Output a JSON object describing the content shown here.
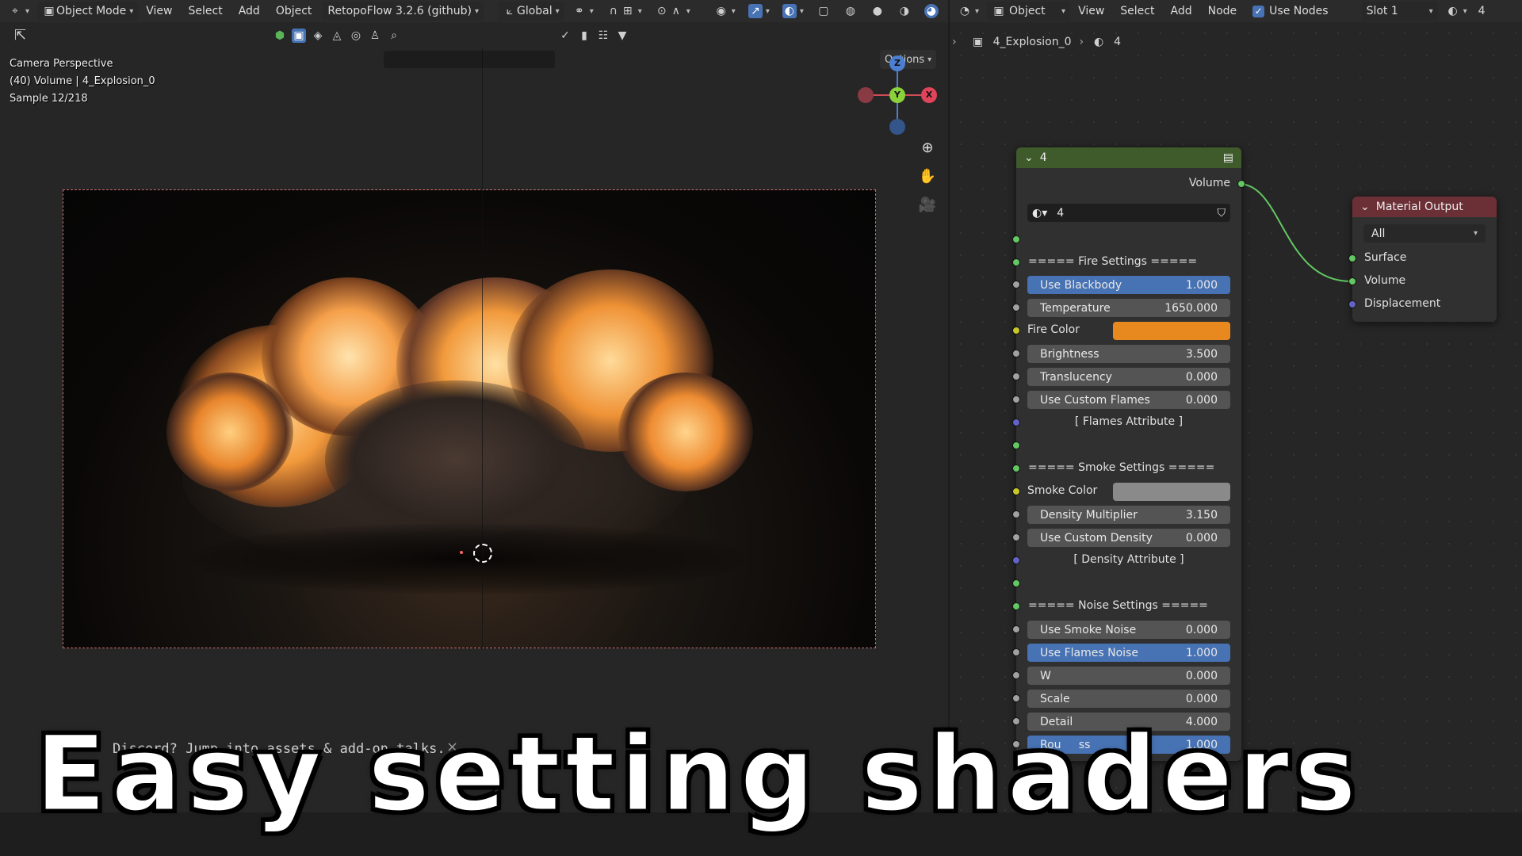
{
  "viewport": {
    "header": {
      "mode": "Object Mode",
      "menus": [
        "View",
        "Select",
        "Add",
        "Object"
      ],
      "addon": "RetopoFlow 3.2.6 (github)",
      "orientation": "Global"
    },
    "options_label": "Options",
    "info": {
      "line1": "Camera Perspective",
      "line2": "(40) Volume | 4_Explosion_0",
      "line3": "Sample 12/218"
    },
    "gizmo": {
      "z": "Z",
      "y": "Y",
      "x": "X"
    },
    "notification": "Discord? Jump into assets & add-on talks.",
    "notification_close": "×"
  },
  "node_editor": {
    "header": {
      "mode": "Object",
      "menus": [
        "View",
        "Select",
        "Add",
        "Node"
      ],
      "use_nodes": "Use Nodes",
      "slot": "Slot 1",
      "material_number": "4"
    },
    "breadcrumb": {
      "object": "4_Explosion_0",
      "material": "4"
    },
    "group_node": {
      "title": "4",
      "output_label": "Volume",
      "datablock": "4",
      "fire_header": "=====  Fire  Settings  =====",
      "use_blackbody": {
        "label": "Use Blackbody",
        "value": "1.000"
      },
      "temperature": {
        "label": "Temperature",
        "value": "1650.000"
      },
      "fire_color": {
        "label": "Fire Color",
        "color": "#e8891f"
      },
      "brightness": {
        "label": "Brightness",
        "value": "3.500"
      },
      "translucency": {
        "label": "Translucency",
        "value": "0.000"
      },
      "use_custom_flames": {
        "label": "Use Custom Flames",
        "value": "0.000"
      },
      "flames_attribute": "[ Flames Attribute ]",
      "smoke_header": "===== Smoke Settings =====",
      "smoke_color": {
        "label": "Smoke Color",
        "color": "#8a8a8a"
      },
      "density_multiplier": {
        "label": "Density Multiplier",
        "value": "3.150"
      },
      "use_custom_density": {
        "label": "Use Custom Density",
        "value": "0.000"
      },
      "density_attribute": "[ Density Attribute ]",
      "noise_header": "=====  Noise Settings  =====",
      "use_smoke_noise": {
        "label": "Use Smoke Noise",
        "value": "0.000"
      },
      "use_flames_noise": {
        "label": "Use Flames Noise",
        "value": "1.000"
      },
      "w": {
        "label": "W",
        "value": "0.000"
      },
      "scale": {
        "label": "Scale",
        "value": "0.000"
      },
      "detail": {
        "label": "Detail",
        "value": "4.000"
      },
      "roughness": {
        "label": "Rou     ss",
        "value": "1.000"
      }
    },
    "material_output": {
      "title": "Material Output",
      "target": "All",
      "inputs": [
        "Surface",
        "Volume",
        "Displacement"
      ]
    }
  },
  "caption": "Easy setting shaders",
  "colors": {
    "accent_blue": "#4772b3",
    "group_header": "#3f5a2b",
    "output_header": "#6b2f36",
    "socket_green": "#63c763",
    "socket_yellow": "#c7c729",
    "socket_grey": "#a1a1a1",
    "socket_purple": "#6363c7",
    "link_green": "#63c763"
  }
}
